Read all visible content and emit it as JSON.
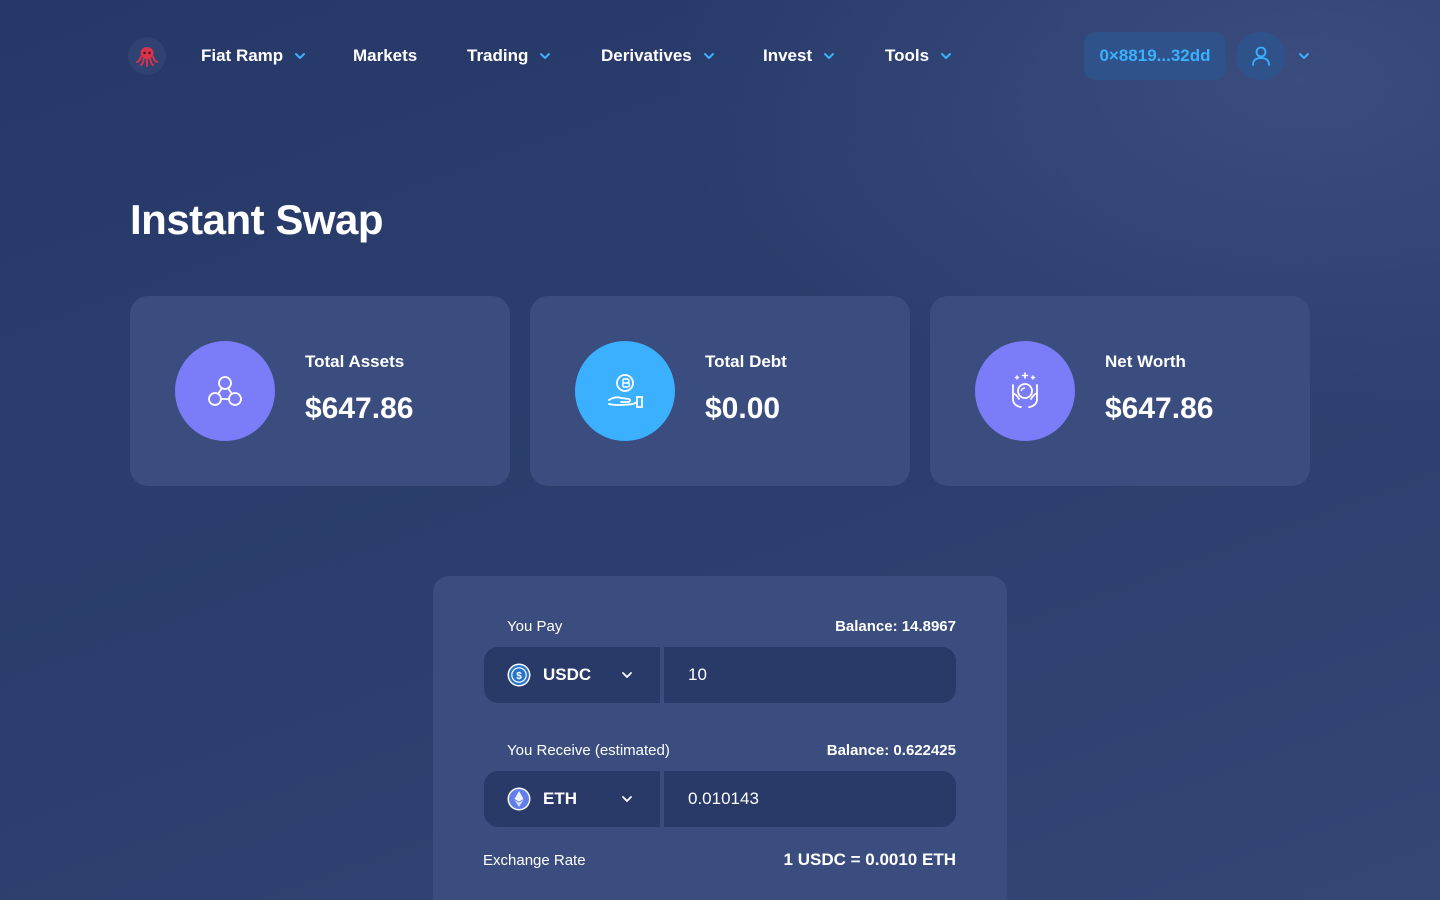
{
  "nav": {
    "logo_icon": "octopus-icon",
    "items": [
      {
        "label": "Fiat Ramp",
        "has_dropdown": true
      },
      {
        "label": "Markets",
        "has_dropdown": false
      },
      {
        "label": "Trading",
        "has_dropdown": true
      },
      {
        "label": "Derivatives",
        "has_dropdown": true
      },
      {
        "label": "Invest",
        "has_dropdown": true
      },
      {
        "label": "Tools",
        "has_dropdown": true
      }
    ],
    "wallet_address": "0×8819...32dd",
    "account_icon": "user-icon"
  },
  "page": {
    "title": "Instant Swap"
  },
  "stats": [
    {
      "label": "Total Assets",
      "value": "$647.86",
      "icon": "network-nodes-icon",
      "icon_bg": "#7b7cf7"
    },
    {
      "label": "Total Debt",
      "value": "$0.00",
      "icon": "bitcoin-hand-icon",
      "icon_bg": "#3ab0ff"
    },
    {
      "label": "Net Worth",
      "value": "$647.86",
      "icon": "hands-coin-sparkle-icon",
      "icon_bg": "#7b7cf7"
    }
  ],
  "swap": {
    "pay": {
      "label": "You Pay",
      "balance": "Balance: 14.8967",
      "token": "USDC",
      "token_icon": "usdc-icon",
      "amount": "10"
    },
    "receive": {
      "label": "You Receive (estimated)",
      "balance": "Balance: 0.622425",
      "token": "ETH",
      "token_icon": "eth-icon",
      "amount": "0.010143"
    },
    "exchange_rate_label": "Exchange Rate",
    "exchange_rate_value": "1 USDC = 0.0010 ETH"
  },
  "colors": {
    "accent_blue": "#3ab0ff",
    "accent_purple": "#7b7cf7",
    "card_bg": "#3a4d7e",
    "page_bg": "#2a3d6c"
  }
}
